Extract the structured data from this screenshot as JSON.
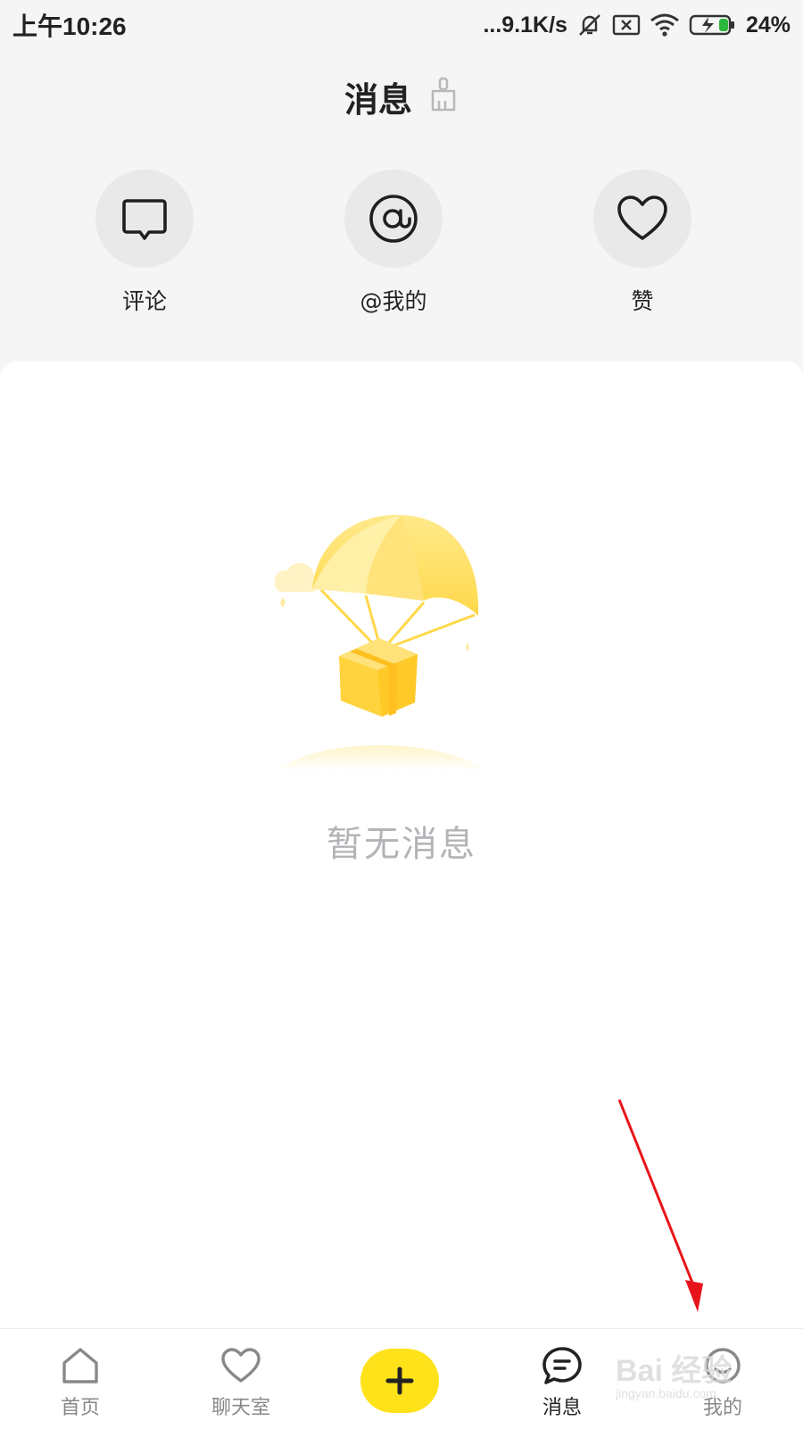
{
  "status_bar": {
    "time": "上午10:26",
    "network_speed": "...9.1K/s",
    "battery": "24%",
    "icons": [
      "mute-bell-icon",
      "sim-off-icon",
      "wifi-icon",
      "battery-charging-icon"
    ]
  },
  "header": {
    "title": "消息",
    "clear_icon": "broom-icon"
  },
  "quick_actions": [
    {
      "label": "评论",
      "icon": "comment-icon"
    },
    {
      "label": "@我的",
      "icon": "at-icon"
    },
    {
      "label": "赞",
      "icon": "heart-icon"
    }
  ],
  "empty_state": {
    "illustration": "parachute-gift-illustration",
    "text": "暂无消息"
  },
  "tab_bar": {
    "tabs": [
      {
        "label": "首页",
        "icon": "home-icon",
        "active": false
      },
      {
        "label": "聊天室",
        "icon": "heart-icon",
        "active": false
      },
      {
        "label": "",
        "icon": "plus-icon",
        "active": false
      },
      {
        "label": "消息",
        "icon": "message-icon",
        "active": true
      },
      {
        "label": "我的",
        "icon": "profile-icon",
        "active": false
      }
    ]
  },
  "watermark": {
    "text": "Bai 经验",
    "sub": "jingyan.baidu.com"
  },
  "colors": {
    "accent": "#ffe21a",
    "annotation_arrow": "#e8141c",
    "muted_text": "#b4b4b8"
  }
}
